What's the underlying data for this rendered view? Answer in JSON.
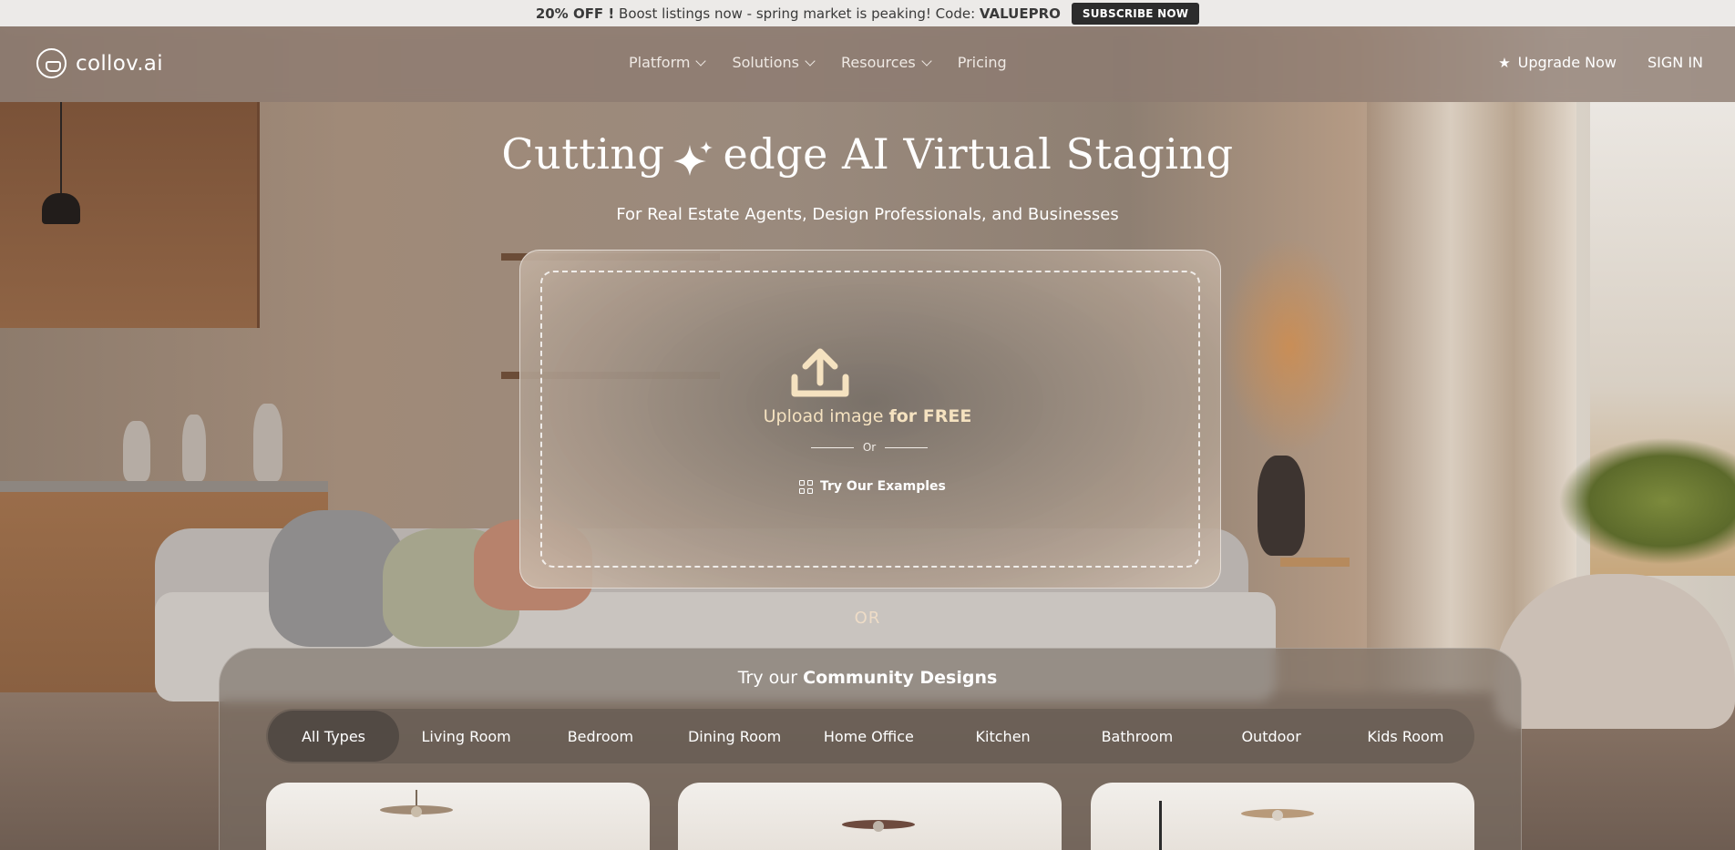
{
  "promo": {
    "discount": "20% OFF !",
    "message": "Boost listings now - spring market is peaking! Code:",
    "code": "VALUEPRO",
    "button": "SUBSCRIBE NOW"
  },
  "header": {
    "logo_text": "collov.ai",
    "nav": [
      {
        "label": "Platform",
        "dropdown": true
      },
      {
        "label": "Solutions",
        "dropdown": true
      },
      {
        "label": "Resources",
        "dropdown": true
      },
      {
        "label": "Pricing",
        "dropdown": false
      }
    ],
    "upgrade": "Upgrade Now",
    "sign_in": "SIGN IN"
  },
  "hero": {
    "title_part1": "Cutting",
    "title_part2": "edge  AI Virtual Staging",
    "subtitle": "For Real Estate Agents, Design Professionals, and Businesses"
  },
  "upload": {
    "text_prefix": "Upload image",
    "text_bold": "for FREE",
    "or": "Or",
    "examples": "Try Our Examples"
  },
  "or_divider": "OR",
  "community": {
    "title_prefix": "Try our",
    "title_bold": "Community Designs",
    "tabs": [
      "All Types",
      "Living Room",
      "Bedroom",
      "Dining Room",
      "Home Office",
      "Kitchen",
      "Bathroom",
      "Outdoor",
      "Kids Room"
    ],
    "active_tab": "All Types"
  },
  "colors": {
    "accent_gold": "#f5e2c0",
    "promo_bg": "#eceae8",
    "promo_button": "#2c2c2c"
  }
}
